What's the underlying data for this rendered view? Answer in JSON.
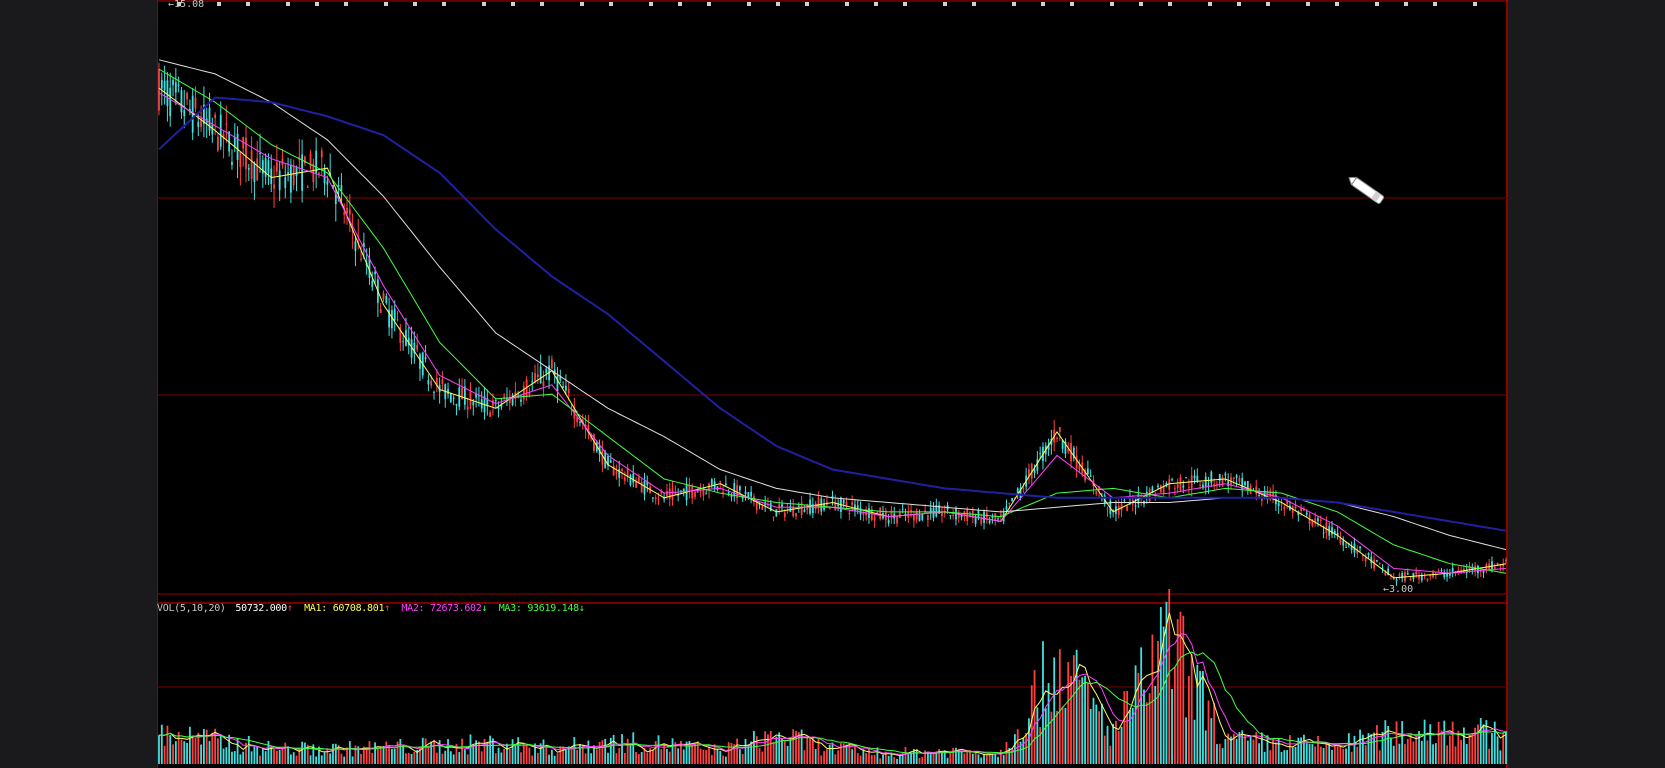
{
  "top_bar": {
    "high_label": "15.08"
  },
  "low_label": "3.00",
  "volume_legend": {
    "indicator": "VOL(5,10,20)",
    "vol_value": "50732.000",
    "vol_arrow": "↑",
    "ma1_label": "MA1:",
    "ma1_value": "60708.801",
    "ma1_arrow": "↑",
    "ma2_label": "MA2:",
    "ma2_value": "72673.602",
    "ma2_arrow": "↓",
    "ma3_label": "MA3:",
    "ma3_value": "93619.148",
    "ma3_arrow": "↓"
  },
  "colors": {
    "background": "#000000",
    "up": "#ff4040",
    "down": "#40e0e0",
    "ma5": "#ffff60",
    "ma10": "#ff40ff",
    "ma20": "#40ff40",
    "ma60": "#e0e0e0",
    "ma120": "#2020a0",
    "grid": "#7a0000",
    "legend_text": "#c8c8c8"
  },
  "chart_data": [
    {
      "type": "line",
      "title": "",
      "x_index": [
        0,
        20,
        40,
        60,
        80,
        100,
        120,
        140,
        160,
        180,
        200,
        220,
        240,
        260,
        280,
        300,
        320,
        340,
        360,
        380,
        400,
        420,
        440,
        460,
        480
      ],
      "series": [
        {
          "name": "",
          "color_key": "ma5",
          "values": [
            13.6,
            12.7,
            11.7,
            11.9,
            9.0,
            7.2,
            6.8,
            7.6,
            5.6,
            4.9,
            5.2,
            4.6,
            4.8,
            4.5,
            4.6,
            4.4,
            6.3,
            4.6,
            5.2,
            5.3,
            4.8,
            4.1,
            3.2,
            3.3,
            3.5
          ]
        },
        {
          "name": "",
          "color_key": "ma10",
          "values": [
            13.5,
            12.8,
            12.1,
            11.7,
            9.4,
            7.5,
            6.9,
            7.3,
            5.8,
            5.0,
            5.1,
            4.7,
            4.7,
            4.5,
            4.6,
            4.4,
            5.8,
            4.9,
            5.0,
            5.2,
            4.9,
            4.3,
            3.4,
            3.3,
            3.4
          ]
        },
        {
          "name": "",
          "color_key": "ma20",
          "values": [
            14.0,
            13.3,
            12.4,
            11.8,
            10.2,
            8.2,
            7.0,
            7.1,
            6.2,
            5.3,
            5.0,
            4.8,
            4.7,
            4.6,
            4.6,
            4.5,
            5.0,
            5.1,
            4.9,
            5.1,
            5.0,
            4.6,
            3.9,
            3.5,
            3.3
          ]
        },
        {
          "name": "",
          "color_key": "ma60",
          "values": [
            14.2,
            13.9,
            13.3,
            12.5,
            11.3,
            9.8,
            8.4,
            7.6,
            6.8,
            6.2,
            5.5,
            5.1,
            4.9,
            4.8,
            4.7,
            4.6,
            4.7,
            4.8,
            4.8,
            4.9,
            4.9,
            4.8,
            4.5,
            4.1,
            3.8
          ]
        },
        {
          "name": "",
          "color_key": "ma120",
          "values": [
            12.3,
            13.4,
            13.3,
            13.0,
            12.6,
            11.8,
            10.6,
            9.6,
            8.8,
            7.8,
            6.8,
            6.0,
            5.5,
            5.3,
            5.1,
            5.0,
            4.9,
            4.9,
            4.9,
            4.9,
            4.9,
            4.8,
            4.6,
            4.4,
            4.2
          ]
        }
      ],
      "high": 15.08,
      "low": 3.0,
      "ylim": [
        2.9,
        15.3
      ]
    },
    {
      "type": "bar",
      "title": "VOL(5,10,20)",
      "x_index": [
        0,
        20,
        40,
        60,
        80,
        100,
        120,
        140,
        160,
        180,
        200,
        220,
        240,
        260,
        280,
        300,
        320,
        340,
        360,
        380,
        400,
        420,
        440,
        460,
        480
      ],
      "values": [
        60000,
        45000,
        30000,
        28000,
        32000,
        35000,
        40000,
        30000,
        42000,
        38000,
        25000,
        55000,
        30000,
        20000,
        25000,
        22000,
        200000,
        60000,
        240000,
        45000,
        40000,
        35000,
        60000,
        70000,
        50732
      ],
      "ylim": [
        0,
        250000
      ]
    }
  ]
}
